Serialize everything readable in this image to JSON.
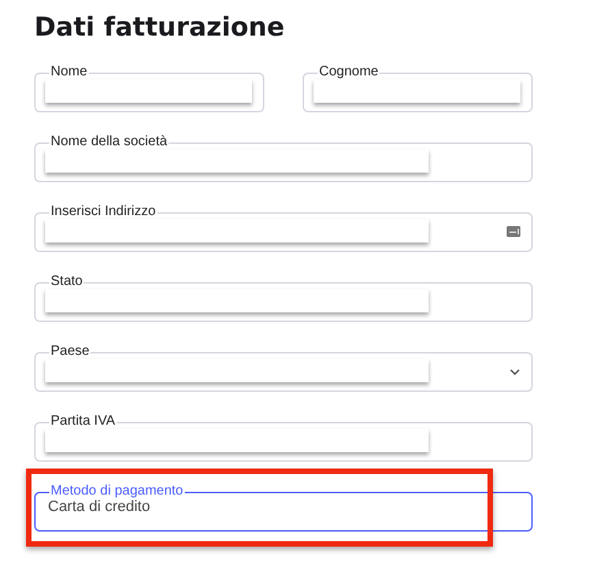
{
  "title": "Dati fatturazione",
  "rows": [
    {
      "fields": [
        {
          "kind": "text",
          "label": "Nome",
          "focused": false,
          "highlighted": false
        },
        {
          "kind": "text",
          "label": "Cognome",
          "focused": false,
          "highlighted": false
        }
      ]
    },
    {
      "fields": [
        {
          "kind": "text",
          "label": "Nome della società",
          "focused": false,
          "highlighted": false
        }
      ]
    },
    {
      "fields": [
        {
          "kind": "address",
          "label": "Inserisci Indirizzo",
          "focused": false,
          "highlighted": false
        }
      ]
    },
    {
      "fields": [
        {
          "kind": "text",
          "label": "Stato",
          "focused": false,
          "highlighted": false
        }
      ]
    },
    {
      "fields": [
        {
          "kind": "select",
          "label": "Paese",
          "focused": false,
          "highlighted": false
        }
      ]
    },
    {
      "fields": [
        {
          "kind": "text",
          "label": "Partita IVA",
          "focused": false,
          "highlighted": false
        }
      ]
    },
    {
      "fields": [
        {
          "kind": "filled",
          "label": "Metodo di pagamento",
          "value": "Carta di credito",
          "focused": true,
          "highlighted": true
        }
      ]
    }
  ]
}
